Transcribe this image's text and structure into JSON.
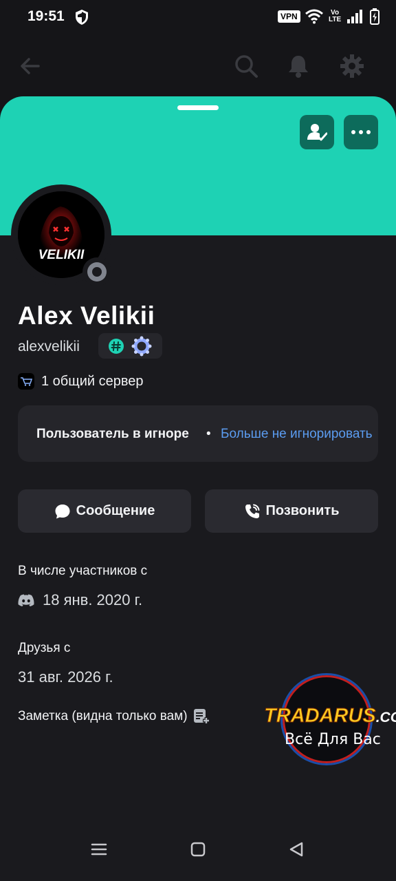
{
  "status_bar": {
    "time": "19:51",
    "vpn": "VPN",
    "volte_top": "Vo",
    "volte_bottom": "LTE",
    "icons": [
      "shield-icon",
      "wifi-icon",
      "signal-icon",
      "battery-charging-icon"
    ]
  },
  "top_nav": {
    "icons": [
      "back-arrow-icon",
      "search-icon",
      "bell-icon",
      "gear-icon"
    ]
  },
  "profile": {
    "banner_color": "#1ed2b4",
    "avatar_text": "VELIKII",
    "display_name": "Alex Velikii",
    "username": "alexvelikii",
    "badges": [
      "hash-badge-icon",
      "nitro-wreath-icon"
    ],
    "mutual_servers": "1 общий сервер",
    "status": "offline"
  },
  "ignore_notice": {
    "text": "Пользователь в игноре",
    "separator": "•",
    "action": "Больше не игнорировать"
  },
  "actions": {
    "message_label": "Сообщение",
    "call_label": "Позвонить"
  },
  "member_since": {
    "label": "В числе участников с",
    "value": "18 янв. 2020 г."
  },
  "friends_since": {
    "label": "Друзья с",
    "value": "31 авг. 2026 г."
  },
  "note": {
    "label": "Заметка (видна только вам)"
  },
  "watermark": {
    "logo": "TRADARUS",
    "domain": ".COM",
    "tagline": "Всё Для Вас"
  },
  "colors": {
    "accent_teal": "#1ed2b4",
    "link_blue": "#5b9cf0",
    "button_dark_teal": "#0d6b5b"
  }
}
